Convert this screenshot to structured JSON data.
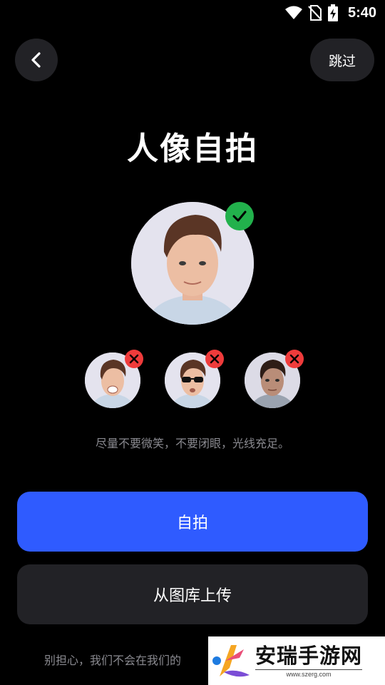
{
  "status_bar": {
    "time": "5:40",
    "icons": [
      "wifi-icon",
      "no-sim-icon",
      "battery-charging-icon"
    ]
  },
  "header": {
    "back_icon": "chevron-left-icon",
    "skip_label": "跳过"
  },
  "title": "人像自拍",
  "examples": {
    "good": {
      "badge": "check-icon",
      "badge_color": "#22b14c"
    },
    "bad": [
      {
        "name": "smiling",
        "badge": "x-icon"
      },
      {
        "name": "sunglasses",
        "badge": "x-icon"
      },
      {
        "name": "dim-light",
        "badge": "x-icon"
      }
    ],
    "bad_badge_color": "#ef3b3b"
  },
  "hint": "尽量不要微笑，不要闭眼，光线充足。",
  "actions": {
    "selfie_label": "自拍",
    "upload_label": "从图库上传",
    "primary_color": "#2f5bff"
  },
  "footer_note": "别担心，我们不会在我们的",
  "watermark": {
    "main": "安瑞手游网",
    "url": "www.szerg.com"
  }
}
